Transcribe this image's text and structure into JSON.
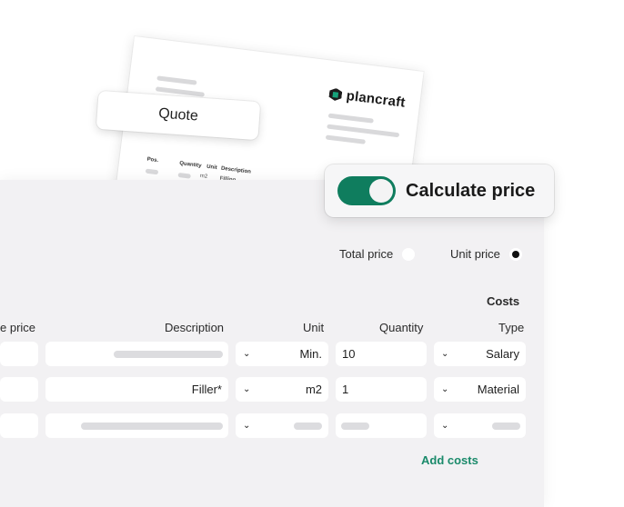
{
  "document": {
    "logo_text": "plancraft",
    "headers": {
      "pos": "Pos.",
      "quantity": "Quantity",
      "unit": "Unit",
      "description": "Description"
    },
    "row1_unit": "m2",
    "row1_desc": "Filling"
  },
  "quote_chip": {
    "label": "Quote"
  },
  "calculate": {
    "label": "Calculate price",
    "enabled": true
  },
  "price_mode": {
    "options": [
      {
        "label": "Total price",
        "selected": false
      },
      {
        "label": "Unit price",
        "selected": true
      }
    ]
  },
  "table": {
    "costs_header": "Costs",
    "columns": {
      "price": "e price",
      "description": "Description",
      "unit": "Unit",
      "quantity": "Quantity",
      "type": "Type"
    },
    "rows": [
      {
        "description": "",
        "unit": "Min.",
        "quantity": "10",
        "type": "Salary"
      },
      {
        "description": "Filler*",
        "unit": "m2",
        "quantity": "1",
        "type": "Material"
      },
      {
        "description": "",
        "unit": "",
        "quantity": "",
        "type": ""
      }
    ],
    "add_costs_label": "Add costs"
  },
  "colors": {
    "accent": "#0f7d5e",
    "link": "#1a8a6a",
    "panel": "#f2f1f3"
  }
}
